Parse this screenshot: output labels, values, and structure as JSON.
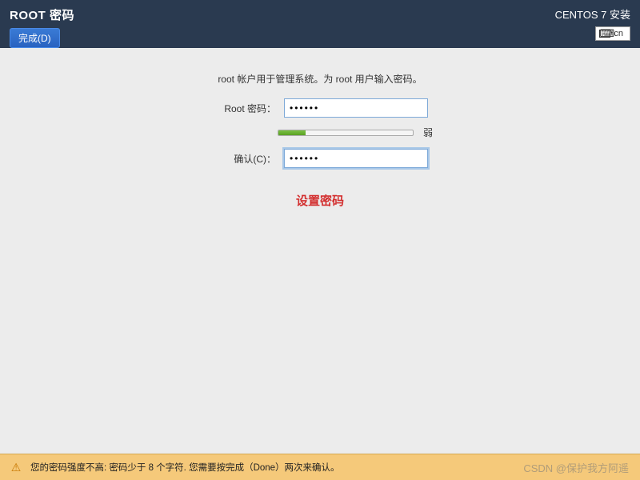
{
  "header": {
    "title": "ROOT 密码",
    "done_button": "完成(D)",
    "installer_title": "CENTOS 7 安装",
    "keyboard_layout": "cn"
  },
  "form": {
    "description": "root 帐户用于管理系统。为 root 用户输入密码。",
    "password_label": "Root 密码：",
    "password_value": "••••••",
    "confirm_label": "确认(C)：",
    "confirm_value": "••••••",
    "strength_label": "弱",
    "strength_percent": 20
  },
  "annotation": {
    "set_password": "设置密码"
  },
  "warning": {
    "message": "您的密码强度不高: 密码少于 8 个字符. 您需要按完成（Done）两次来确认。"
  },
  "watermark": "CSDN @保护我方阿遥"
}
